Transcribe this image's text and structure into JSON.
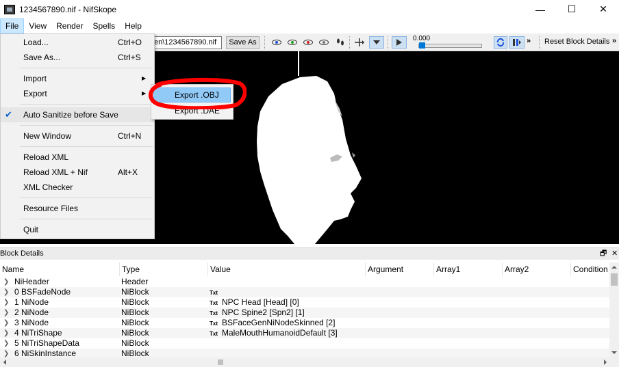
{
  "window": {
    "title": "1234567890.nif - NifSkope",
    "min_glyph": "—",
    "max_glyph": "☐",
    "close_glyph": "✕"
  },
  "menubar": {
    "items": [
      "File",
      "View",
      "Render",
      "Spells",
      "Help"
    ]
  },
  "toolbar": {
    "path_value": "en\\1234567890.nif",
    "save_as_label": "Save As",
    "time_value": "0.000",
    "time_progress": 0.0,
    "reset_label": "Reset Block Details",
    "overflow_glyph": "»",
    "icons": [
      "eye-blue-icon",
      "eye-green-icon",
      "eye-red-icon",
      "eye-gray-icon",
      "footprints-icon",
      "axis-icon",
      "view-dropdown-icon",
      "play-icon",
      "loop-icon",
      "switch-icon"
    ]
  },
  "file_menu": {
    "items": [
      {
        "label": "Load...",
        "shortcut": "Ctrl+O"
      },
      {
        "label": "Save As...",
        "shortcut": "Ctrl+S"
      },
      {
        "label": "Import",
        "submenu": true
      },
      {
        "label": "Export",
        "submenu": true
      },
      {
        "label": "Auto Sanitize before Save",
        "checked": true
      },
      {
        "label": "New Window",
        "shortcut": "Ctrl+N"
      },
      {
        "label": "Reload XML"
      },
      {
        "label": "Reload XML + Nif",
        "shortcut": "Alt+X"
      },
      {
        "label": "XML Checker"
      },
      {
        "label": "Resource Files"
      },
      {
        "label": "Quit"
      }
    ]
  },
  "export_submenu": {
    "items": [
      "Export .OBJ",
      "Export .DAE"
    ],
    "highlighted": "Export .OBJ"
  },
  "block_details": {
    "title": "Block Details",
    "float_glyph": "🗗",
    "close_glyph": "✕",
    "columns": [
      "Name",
      "Type",
      "Value",
      "Argument",
      "Array1",
      "Array2",
      "Condition"
    ],
    "rows": [
      {
        "name": "NiHeader",
        "type": "Header",
        "txt": "",
        "value": ""
      },
      {
        "name": "0 BSFadeNode",
        "type": "NiBlock",
        "txt": "Txt",
        "value": ""
      },
      {
        "name": "1 NiNode",
        "type": "NiBlock",
        "txt": "Txt",
        "value": "NPC Head [Head] [0]"
      },
      {
        "name": "2 NiNode",
        "type": "NiBlock",
        "txt": "Txt",
        "value": "NPC Spine2 [Spn2] [1]"
      },
      {
        "name": "3 NiNode",
        "type": "NiBlock",
        "txt": "Txt",
        "value": "BSFaceGenNiNodeSkinned [2]"
      },
      {
        "name": "4 NiTriShape",
        "type": "NiBlock",
        "txt": "Txt",
        "value": "MaleMouthHumanoidDefault [3]"
      },
      {
        "name": "5 NiTriShapeData",
        "type": "NiBlock",
        "txt": "",
        "value": ""
      },
      {
        "name": "6 NiSkinInstance",
        "type": "NiBlock",
        "txt": "",
        "value": ""
      }
    ]
  },
  "colors": {
    "accent": "#0078d7",
    "menu_highlight": "#91c9f7",
    "annotation": "#ff0000",
    "viewport_bg": "#000000"
  }
}
